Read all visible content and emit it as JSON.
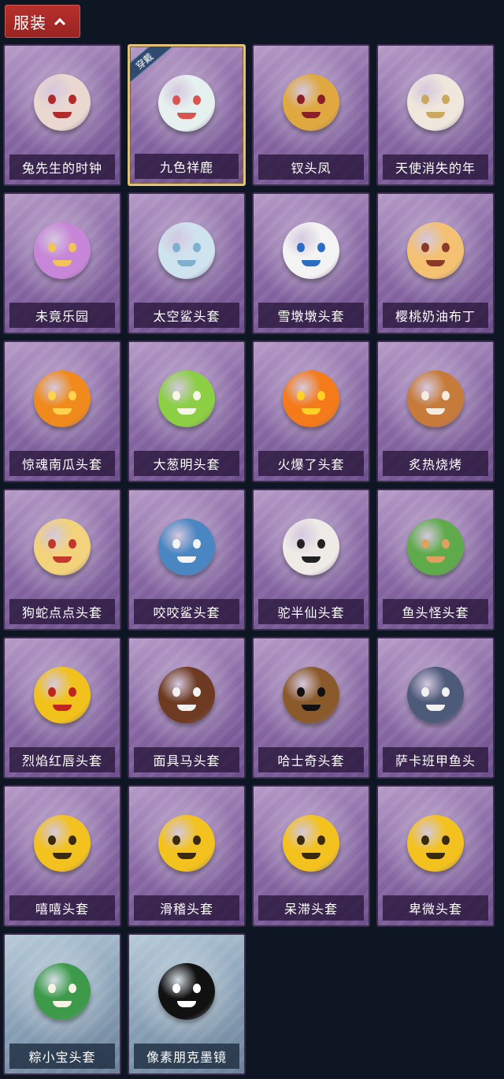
{
  "header": {
    "title": "服装",
    "chevron_icon": "chevron-up-icon"
  },
  "wear_badge": "穿戴",
  "items": [
    {
      "label": "兔先生的时钟",
      "icon": "rabbit-clock-costume-icon",
      "color": "#e9d7d0",
      "accent": "#b22a2a",
      "style": "purple"
    },
    {
      "label": "九色祥鹿",
      "icon": "nine-color-deer-icon",
      "color": "#e6f1ef",
      "accent": "#d9534f",
      "style": "purple",
      "selected": true
    },
    {
      "label": "钗头凤",
      "icon": "phoenix-crown-costume-icon",
      "color": "#e0a840",
      "accent": "#8a1f28",
      "style": "purple"
    },
    {
      "label": "天使消失的年",
      "icon": "angel-costume-icon",
      "color": "#efe6dc",
      "accent": "#caa85e",
      "style": "purple"
    },
    {
      "label": "未竟乐园",
      "icon": "unfinished-paradise-costume-icon",
      "color": "#c786d8",
      "accent": "#f1c35a",
      "style": "purple"
    },
    {
      "label": "太空鲨头套",
      "icon": "space-shark-head-icon",
      "color": "#cfe3ef",
      "accent": "#7fb0d0",
      "style": "purple"
    },
    {
      "label": "雪墩墩头套",
      "icon": "snow-dundun-head-icon",
      "color": "#f3f3f3",
      "accent": "#2b6cc4",
      "style": "purple"
    },
    {
      "label": "樱桃奶油布丁",
      "icon": "cherry-pudding-icon",
      "color": "#f4c173",
      "accent": "#8b3a2a",
      "style": "purple"
    },
    {
      "label": "惊魂南瓜头套",
      "icon": "pumpkin-head-icon",
      "color": "#f08a1c",
      "accent": "#ffd34d",
      "style": "purple"
    },
    {
      "label": "大葱明头套",
      "icon": "scallion-head-icon",
      "color": "#8ccf45",
      "accent": "#f5f5e8",
      "style": "purple"
    },
    {
      "label": "火爆了头套",
      "icon": "fire-head-icon",
      "color": "#f47a1a",
      "accent": "#ffd027",
      "style": "purple"
    },
    {
      "label": "炙热烧烤",
      "icon": "bbq-meat-head-icon",
      "color": "#c77b3a",
      "accent": "#f3ece0",
      "style": "purple"
    },
    {
      "label": "狗蛇点点头套",
      "icon": "dog-snake-head-icon",
      "color": "#f2d27a",
      "accent": "#c0392b",
      "style": "purple"
    },
    {
      "label": "咬咬鲨头套",
      "icon": "biting-shark-head-icon",
      "color": "#4a86c2",
      "accent": "#f4f4f4",
      "style": "purple"
    },
    {
      "label": "驼半仙头套",
      "icon": "alpaca-sunglasses-head-icon",
      "color": "#eeeae6",
      "accent": "#222222",
      "style": "purple"
    },
    {
      "label": "鱼头怪头套",
      "icon": "fish-head-monster-icon",
      "color": "#5faa4a",
      "accent": "#e0a060",
      "style": "purple"
    },
    {
      "label": "烈焰红唇头套",
      "icon": "red-lips-yellow-mask-icon",
      "color": "#f1c21b",
      "accent": "#c0241f",
      "style": "purple"
    },
    {
      "label": "面具马头套",
      "icon": "horse-mask-head-icon",
      "color": "#6e3b22",
      "accent": "#f2f2f2",
      "style": "purple"
    },
    {
      "label": "哈士奇头套",
      "icon": "husky-head-icon",
      "color": "#8b5a2b",
      "accent": "#111111",
      "style": "purple"
    },
    {
      "label": "萨卡班甲鱼头",
      "icon": "sacabambaspis-head-icon",
      "color": "#4d5a7a",
      "accent": "#f1f1f1",
      "style": "purple"
    },
    {
      "label": "嘻嘻头套",
      "icon": "grinning-emoji-head-icon",
      "color": "#f3c21f",
      "accent": "#3a2a10",
      "style": "purple"
    },
    {
      "label": "滑稽头套",
      "icon": "funny-smile-emoji-head-icon",
      "color": "#f3c21f",
      "accent": "#3a2a10",
      "style": "purple"
    },
    {
      "label": "呆滞头套",
      "icon": "dazed-emoji-head-icon",
      "color": "#f3c21f",
      "accent": "#3a2a10",
      "style": "purple"
    },
    {
      "label": "卑微头套",
      "icon": "humble-emoji-head-icon",
      "color": "#f3c21f",
      "accent": "#3a2a10",
      "style": "purple"
    },
    {
      "label": "粽小宝头套",
      "icon": "zongzi-head-icon",
      "color": "#3c9a4a",
      "accent": "#f7f2e6",
      "style": "blue"
    },
    {
      "label": "像素朋克墨镜",
      "icon": "pixel-sunglasses-icon",
      "color": "#111111",
      "accent": "#ffffff",
      "style": "blue"
    }
  ]
}
